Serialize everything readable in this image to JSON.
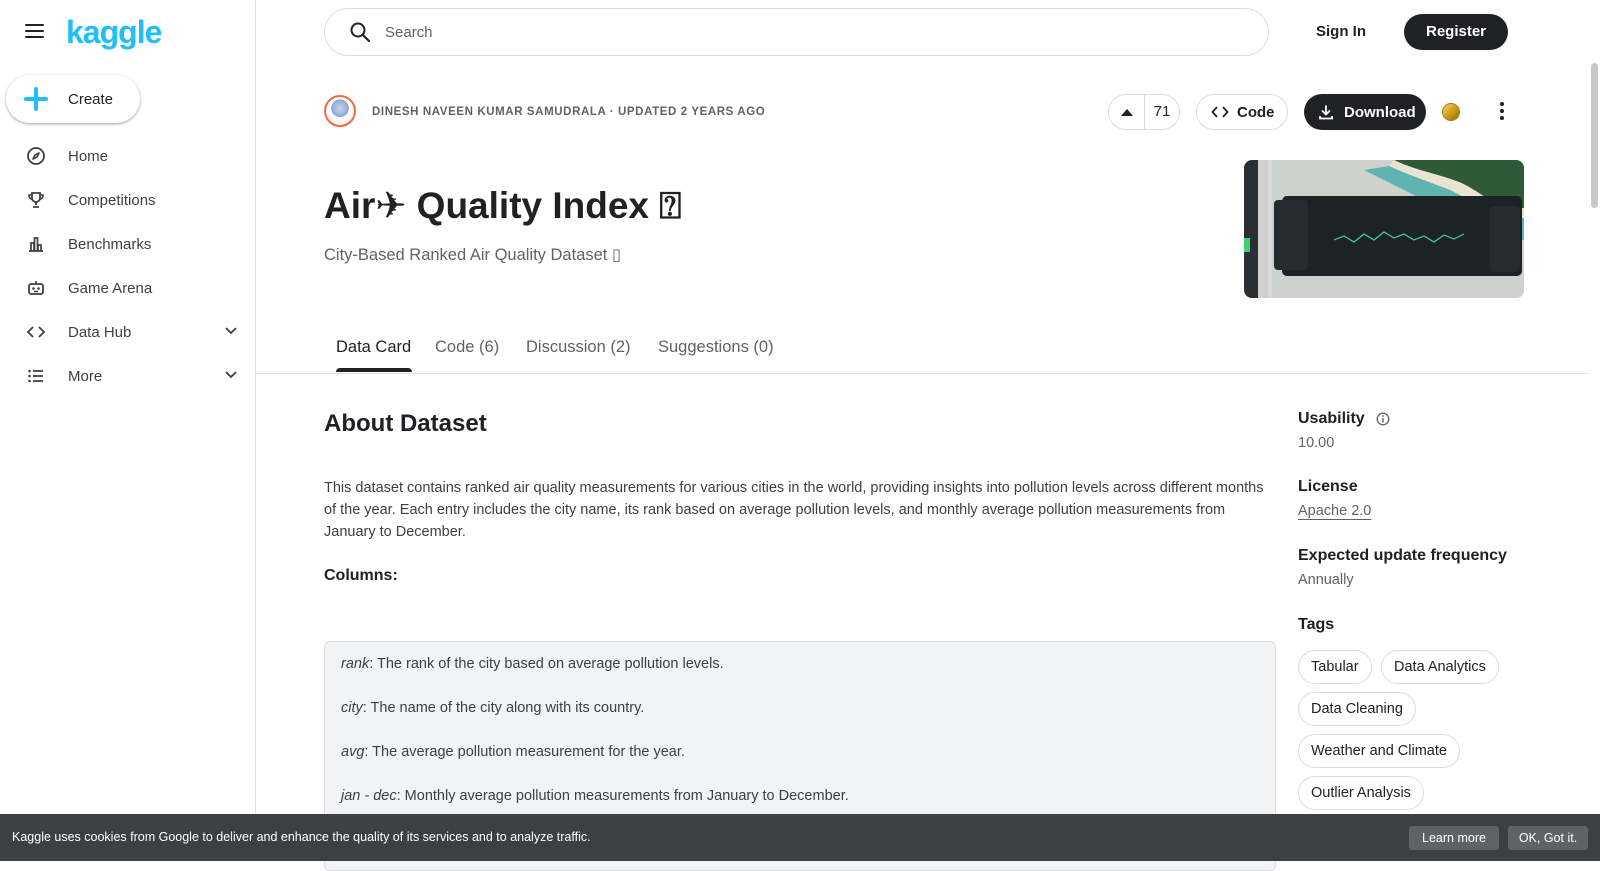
{
  "app": {
    "logo": "kaggle"
  },
  "sidebar": {
    "create_label": "Create",
    "items": [
      {
        "label": "Home",
        "icon": "compass-icon"
      },
      {
        "label": "Competitions",
        "icon": "trophy-icon"
      },
      {
        "label": "Benchmarks",
        "icon": "bar-chart-icon"
      },
      {
        "label": "Game Arena",
        "icon": "robot-icon"
      },
      {
        "label": "Data Hub",
        "icon": "code-brackets-icon"
      },
      {
        "label": "More",
        "icon": "list-icon"
      }
    ]
  },
  "header": {
    "search_placeholder": "Search",
    "signin_label": "Sign In",
    "register_label": "Register"
  },
  "dataset": {
    "byline": "DINESH NAVEEN KUMAR SAMUDRALA · UPDATED 2 YEARS AGO",
    "upvotes": "71",
    "code_label": "Code",
    "download_label": "Download",
    "title": "Air✈ Quality Index ⍰",
    "subtitle": "City-Based Ranked Air Quality Dataset ▯"
  },
  "tabs": [
    {
      "label": "Data Card",
      "active": true
    },
    {
      "label": "Code (6)",
      "active": false
    },
    {
      "label": "Discussion (2)",
      "active": false
    },
    {
      "label": "Suggestions (0)",
      "active": false
    }
  ],
  "about": {
    "heading": "About Dataset",
    "description": "This dataset contains ranked air quality measurements for various cities in the world, providing insights into pollution levels across different months of the year. Each entry includes the city name, its rank based on average pollution levels, and monthly average pollution measurements from January to December.",
    "columns_heading": "Columns:",
    "columns": [
      {
        "name": "rank",
        "desc": ": The rank of the city based on average pollution levels."
      },
      {
        "name": "city",
        "desc": ": The name of the city along with its country."
      },
      {
        "name": "avg",
        "desc": ": The average pollution measurement for the year."
      },
      {
        "name": "jan - dec",
        "desc": ": Monthly average pollution measurements from January to December."
      }
    ]
  },
  "meta": {
    "usability_label": "Usability",
    "usability_value": "10.00",
    "license_label": "License",
    "license_value": "Apache 2.0",
    "frequency_label": "Expected update frequency",
    "frequency_value": "Annually",
    "tags_label": "Tags",
    "tags": [
      "Tabular",
      "Data Analytics",
      "Data Cleaning",
      "Weather and Climate",
      "Outlier Analysis"
    ]
  },
  "cookie": {
    "message": "Kaggle uses cookies from Google to deliver and enhance the quality of its services and to analyze traffic.",
    "learn_more": "Learn more",
    "ok": "OK, Got it."
  },
  "colors": {
    "brand": "#20beff",
    "dark": "#202124",
    "muted": "#5f6368",
    "cookie_bg": "#3c4043"
  }
}
